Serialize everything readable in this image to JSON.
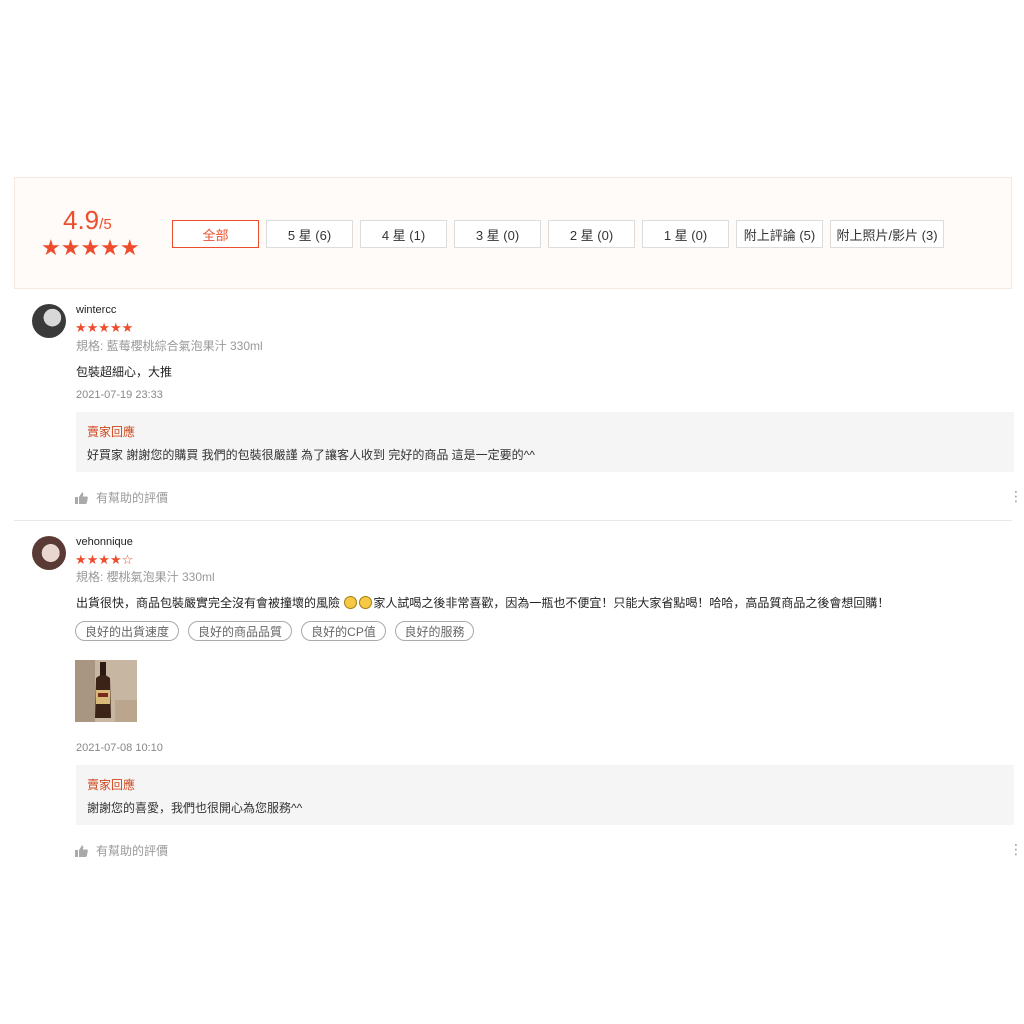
{
  "rating_summary": {
    "score": "4.9",
    "out_of": "/5",
    "stars": "★★★★★",
    "filters": [
      {
        "label": "全部",
        "active": true
      },
      {
        "label": "5 星 (6)",
        "active": false
      },
      {
        "label": "4 星 (1)",
        "active": false
      },
      {
        "label": "3 星 (0)",
        "active": false
      },
      {
        "label": "2 星 (0)",
        "active": false
      },
      {
        "label": "1 星 (0)",
        "active": false
      },
      {
        "label": "附上評論 (5)",
        "active": false
      },
      {
        "label": "附上照片/影片 (3)",
        "active": false
      }
    ]
  },
  "reviews": [
    {
      "username": "wintercc",
      "stars": "★★★★★",
      "rating": 5,
      "variant": "規格: 藍莓櫻桃綜合氣泡果汁 330ml",
      "comment": "包裝超細心，大推",
      "timestamp": "2021-07-19 23:33",
      "reply_title": "賣家回應",
      "reply_text": "好買家 謝謝您的購買 我們的包裝很嚴謹 為了讓客人收到 完好的商品 這是一定要的^^",
      "helpful_label": "有幫助的評價"
    },
    {
      "username": "vehonnique",
      "stars": "★★★★☆",
      "rating": 4,
      "variant": "規格: 櫻桃氣泡果汁 330ml",
      "comment_part1": "出貨很快，商品包裝嚴實完全沒有會被撞壞的風險 ",
      "comment_part2": "家人試喝之後非常喜歡，因為一瓶也不便宜！只能大家省點喝！哈哈，高品質商品之後會想回購！",
      "tags": [
        "良好的出貨速度",
        "良好的商品品質",
        "良好的CP值",
        "良好的服務"
      ],
      "timestamp": "2021-07-08 10:10",
      "reply_title": "賣家回應",
      "reply_text": "謝謝您的喜愛，我們也很開心為您服務^^",
      "helpful_label": "有幫助的評價"
    }
  ],
  "colors": {
    "accent": "#ee4d2d",
    "reply_title": "#d0471c"
  },
  "icons": {
    "thumb": "thumbs-up-icon",
    "more": "more-vertical-icon",
    "emoji": "laughing-emoji-icon"
  }
}
